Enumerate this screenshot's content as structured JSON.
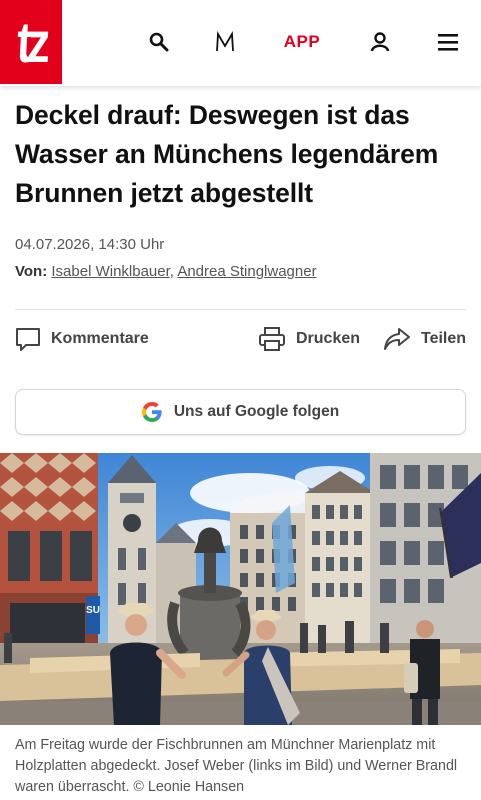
{
  "header": {
    "logo_text": "tz",
    "app_label": "APP",
    "icons": [
      "search-icon",
      "m-icon",
      "user-icon",
      "menu-icon"
    ],
    "brand_color": "#e2001a"
  },
  "article": {
    "headline": "Deckel drauf: Deswegen ist das Wasser an Münchens legendärem Brunnen jetzt abgestellt",
    "date": "04.07.2026, 14:30 Uhr",
    "byline_prefix": "Von:",
    "authors": [
      "Isabel Winklbauer",
      "Andrea Stinglwagner"
    ],
    "author_separator": ","
  },
  "actions": {
    "comments_label": "Kommentare",
    "print_label": "Drucken",
    "share_label": "Teilen"
  },
  "google_follow": {
    "label": "Uns auf Google folgen"
  },
  "photo": {
    "caption": "Am Freitag wurde der Fischbrunnen am Münchner Marienplatz mit Holzplatten abgedeckt. Josef Weber (links im Bild) und Werner Brandl waren überrascht. © Leonie Hansen",
    "sign_letters": "SU"
  }
}
